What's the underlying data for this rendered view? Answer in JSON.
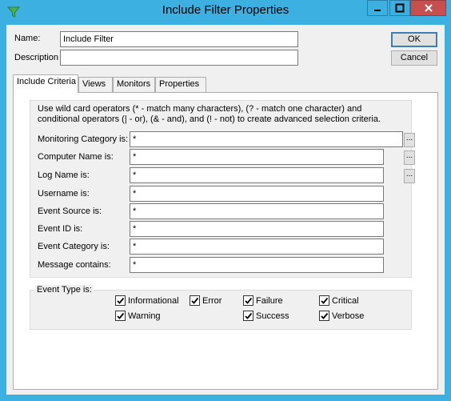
{
  "window": {
    "title": "Include Filter Properties",
    "controls": [
      "minimize",
      "maximize",
      "close"
    ]
  },
  "header": {
    "name_label": "Name:",
    "name_value": "Include Filter",
    "description_label": "Description",
    "description_value": "",
    "ok_label": "OK",
    "cancel_label": "Cancel"
  },
  "tabs": [
    {
      "label": "Include Criteria",
      "active": true
    },
    {
      "label": "Views",
      "active": false
    },
    {
      "label": "Monitors",
      "active": false
    },
    {
      "label": "Properties",
      "active": false
    }
  ],
  "criteria": {
    "description": "Use wild card operators (* - match many characters), (? - match one character) and conditional operators (| - or), (& - and), and (! - not) to create advanced selection criteria.",
    "fields": [
      {
        "label": "Monitoring Category is:",
        "value": "*",
        "browse": "..."
      },
      {
        "label": "Computer Name is:",
        "value": "*",
        "browse": "..."
      },
      {
        "label": "Log Name is:",
        "value": "*",
        "browse": "..."
      },
      {
        "label": "Username is:",
        "value": "*"
      },
      {
        "label": "Event Source is:",
        "value": "*"
      },
      {
        "label": "Event ID is:",
        "value": "*"
      },
      {
        "label": "Event Category is:",
        "value": "*"
      },
      {
        "label": "Message contains:",
        "value": "*"
      }
    ]
  },
  "event_type": {
    "label": "Event Type is:",
    "options": [
      {
        "label": "Informational",
        "checked": true
      },
      {
        "label": "Error",
        "checked": true
      },
      {
        "label": "Failure",
        "checked": true
      },
      {
        "label": "Critical",
        "checked": true
      },
      {
        "label": "Warning",
        "checked": true
      },
      {
        "label": "Success",
        "checked": true
      },
      {
        "label": "Verbose",
        "checked": true
      }
    ]
  },
  "colors": {
    "titlebar": "#3cb0e0",
    "close_button": "#c7504f",
    "dialog_background": "#f0f0f0",
    "default_button_border": "#3c7fb1"
  },
  "icons": {
    "app": "filter-icon",
    "minimize": "minimize-icon",
    "maximize": "maximize-icon",
    "close": "close-icon",
    "check": "checkmark-icon"
  }
}
